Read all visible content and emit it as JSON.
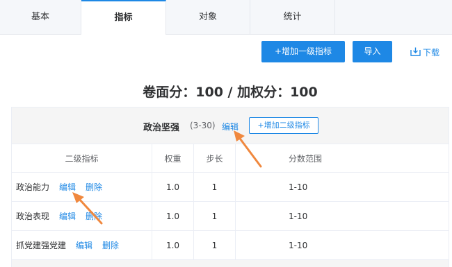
{
  "tabs": [
    {
      "label": "基本",
      "active": false
    },
    {
      "label": "指标",
      "active": true
    },
    {
      "label": "对象",
      "active": false
    },
    {
      "label": "统计",
      "active": false
    }
  ],
  "toolbar": {
    "add_level1": "+增加一级指标",
    "import": "导入",
    "download": "下载"
  },
  "score_title": "卷面分：100 / 加权分：100",
  "group": {
    "name": "政治坚强",
    "range": "(3-30)",
    "edit": "编辑",
    "add_level2": "+增加二级指标"
  },
  "table": {
    "headers": [
      "二级指标",
      "权重",
      "步长",
      "分数范围"
    ],
    "rows": [
      {
        "name": "政治能力",
        "edit": "编辑",
        "delete": "删除",
        "weight": "1.0",
        "step": "1",
        "range": "1-10"
      },
      {
        "name": "政治表现",
        "edit": "编辑",
        "delete": "删除",
        "weight": "1.0",
        "step": "1",
        "range": "1-10"
      },
      {
        "name": "抓党建强党建",
        "edit": "编辑",
        "delete": "删除",
        "weight": "1.0",
        "step": "1",
        "range": "1-10"
      }
    ]
  },
  "colors": {
    "accent": "#1e88e5",
    "annotation": "#f0883e"
  }
}
